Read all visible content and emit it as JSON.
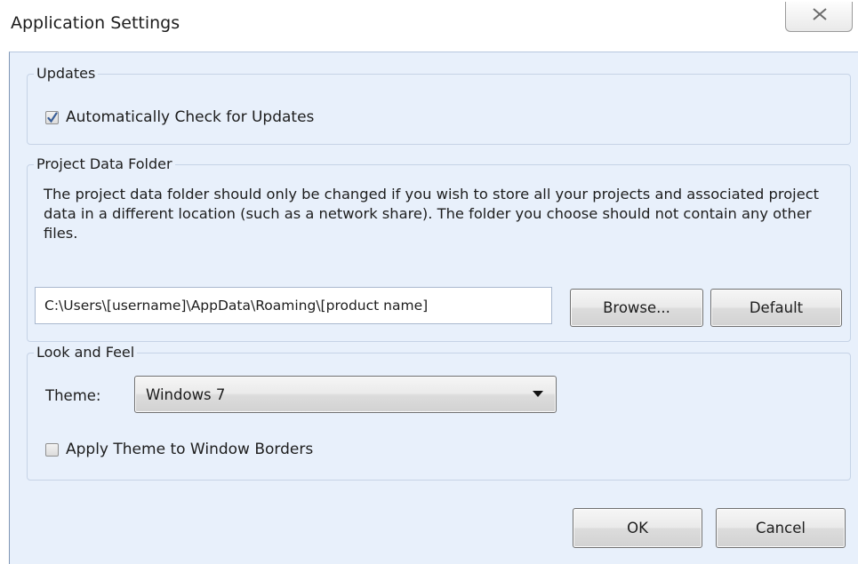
{
  "window": {
    "title": "Application Settings",
    "close_icon": "close-x-icon"
  },
  "updates": {
    "group_label": "Updates",
    "auto_check_label": "Automatically Check for Updates",
    "auto_check_checked": true
  },
  "project_data_folder": {
    "group_label": "Project Data Folder",
    "description": "The project data folder should only be changed if you wish to store all your projects and associated project data in a different location (such as a network share). The folder you choose should not contain any other files.",
    "path_value": "C:\\Users\\[username]\\AppData\\Roaming\\[product name]",
    "browse_label": "Browse...",
    "default_label": "Default"
  },
  "look_and_feel": {
    "group_label": "Look and Feel",
    "theme_label": "Theme:",
    "theme_value": "Windows 7",
    "apply_borders_label": "Apply Theme to Window Borders",
    "apply_borders_checked": false
  },
  "footer": {
    "ok_label": "OK",
    "cancel_label": "Cancel"
  },
  "colors": {
    "client_background": "#e8f0fb",
    "group_border": "#c6d3e6"
  }
}
